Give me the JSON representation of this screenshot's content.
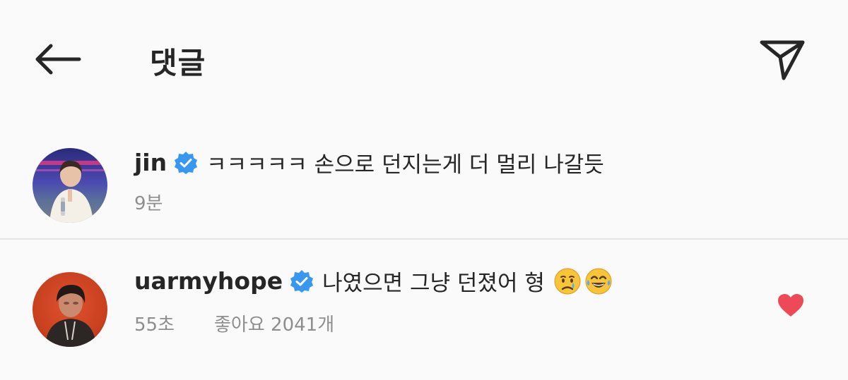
{
  "header": {
    "title": "댓글",
    "back_icon": "arrow-left-icon",
    "send_icon": "paper-plane-icon"
  },
  "comments": [
    {
      "username": "jin",
      "verified": true,
      "text": "ㅋㅋㅋㅋㅋ 손으로 던지는게 더 멀리 나갈듯",
      "time": "9분"
    },
    {
      "username": "uarmyhope",
      "verified": true,
      "text": "나였으면 그냥 던졌어 형",
      "emojis": [
        "crying-face-emoji",
        "tears-of-joy-emoji"
      ],
      "time": "55초",
      "likes": "좋아요 2041개",
      "liked": true
    }
  ],
  "colors": {
    "verified": "#3897f0",
    "liked_heart": "#ed4956",
    "secondary_text": "#8e8e8e"
  }
}
